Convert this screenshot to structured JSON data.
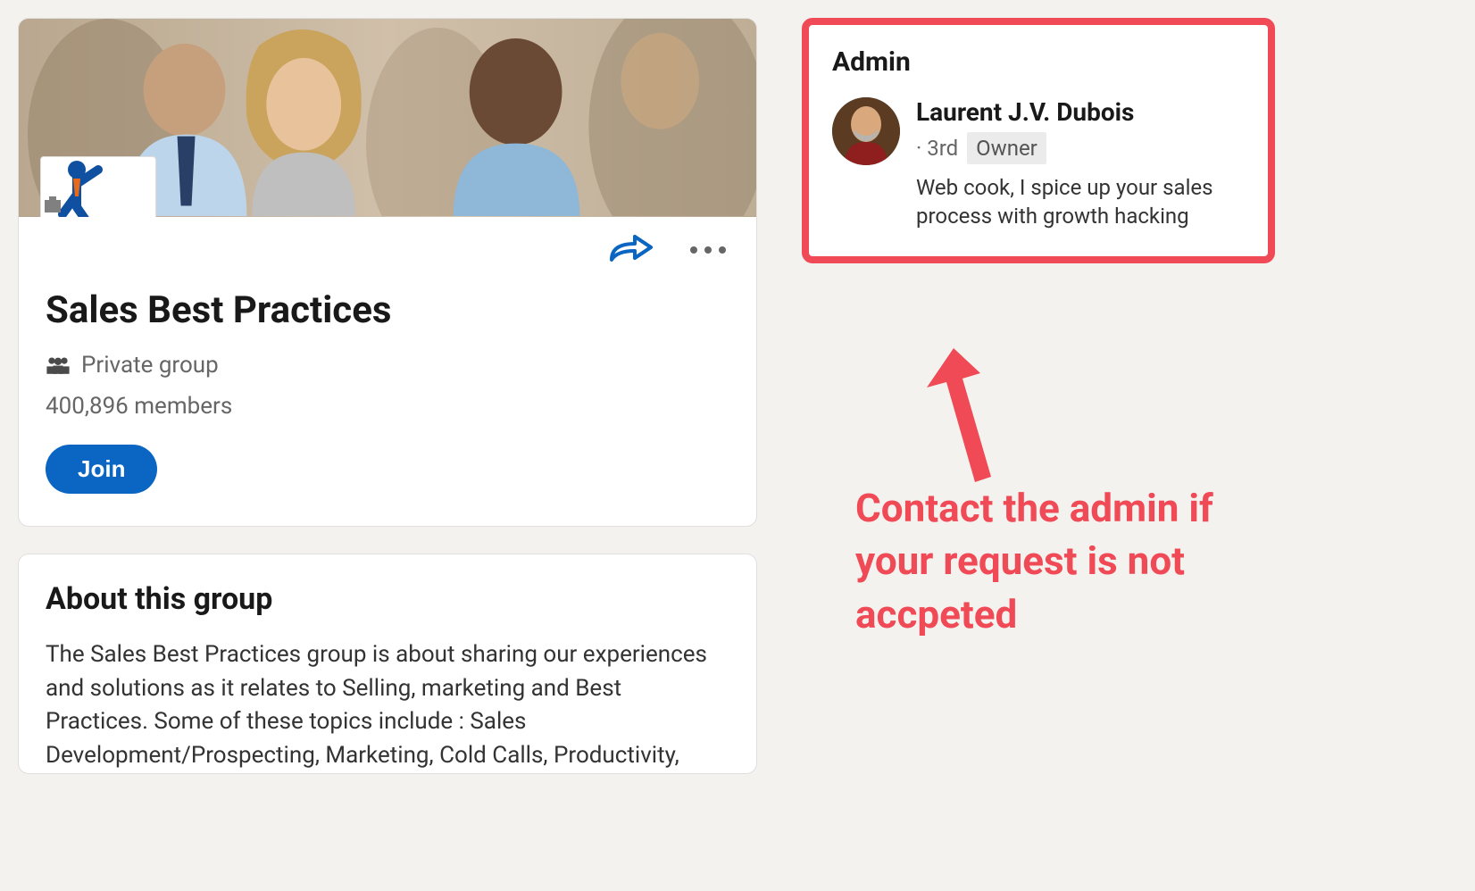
{
  "group": {
    "name": "Sales Best Practices",
    "privacy_label": "Private group",
    "members_text": "400,896 members",
    "join_label": "Join"
  },
  "about": {
    "heading": "About this group",
    "description": "The Sales Best Practices group is about sharing our experiences and solutions as it relates to Selling, marketing and Best Practices. Some of these topics include : Sales Development/Prospecting,  Marketing, Cold Calls, Productivity,"
  },
  "admin": {
    "section_title": "Admin",
    "name": "Laurent J.V. Dubois",
    "connection_degree": "· 3rd",
    "role_badge": "Owner",
    "bio": "Web cook, I spice up your sales process with growth hacking"
  },
  "annotation": {
    "text": "Contact the admin if your request is not accpeted"
  }
}
